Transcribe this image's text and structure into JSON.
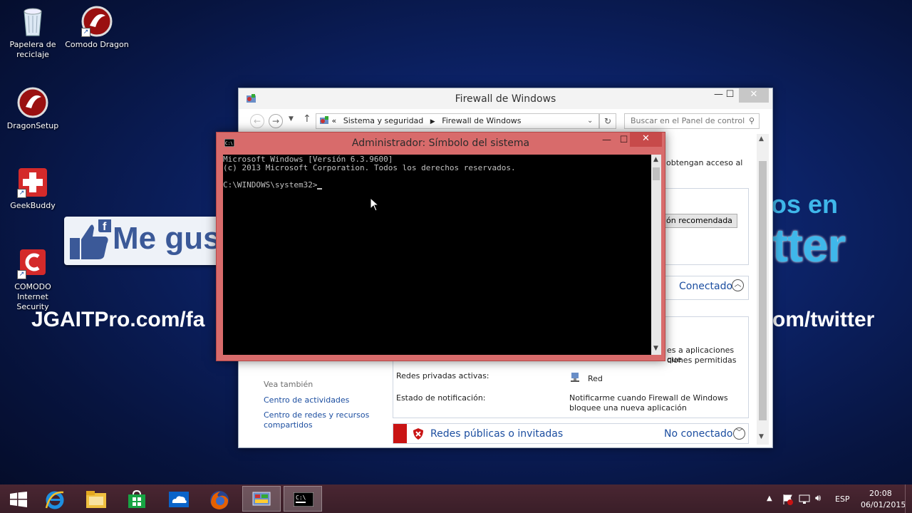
{
  "desktop": {
    "icons": [
      {
        "label": "Papelera de reciclaje",
        "icon": "recycle-bin-icon"
      },
      {
        "label": "Comodo Dragon",
        "icon": "comodo-dragon-icon"
      },
      {
        "label": "DragonSetup",
        "icon": "dragon-setup-icon"
      },
      {
        "label": "GeekBuddy",
        "icon": "geekbuddy-icon"
      },
      {
        "label": "COMODO Internet Security",
        "icon": "comodo-security-icon"
      }
    ],
    "wallpaper": {
      "like_text": "Me gus",
      "facebook_url": "JGAITPro.com/fa",
      "twitter_url": "om/twitter",
      "twitter_head": "os en",
      "twitter_word": "tter"
    }
  },
  "firewall_window": {
    "title": "Firewall de Windows",
    "breadcrumb": [
      "Sistema y seguridad",
      "Firewall de Windows"
    ],
    "breadcrumb_prefix": "«",
    "search_placeholder": "Buscar en el Panel de control",
    "controls": {
      "minimize": "—",
      "maximize": "☐",
      "close": "✕"
    },
    "text_fragment_access": "obtengan acceso al",
    "button_recommended": "ón recomendada",
    "private_status": "Conectado",
    "fragment_apps_1": "es a aplicaciones que",
    "fragment_apps_2": "ciones permitidas",
    "active_private_label": "Redes privadas activas:",
    "active_private_value": "Red",
    "notify_label": "Estado de notificación:",
    "notify_value_1": "Notificarme cuando Firewall de Windows",
    "notify_value_2": "bloquee una nueva aplicación",
    "see_also": "Vea también",
    "link_activity_center": "Centro de actividades",
    "link_network_center_1": "Centro de redes y recursos",
    "link_network_center_2": "compartidos",
    "public_networks_label": "Redes públicas o invitadas",
    "public_status": "No conectado"
  },
  "cmd_window": {
    "title": "Administrador: Símbolo del sistema",
    "controls": {
      "minimize": "—",
      "maximize": "☐",
      "close": "✕"
    },
    "lines": [
      "Microsoft Windows [Versión 6.3.9600]",
      "(c) 2013 Microsoft Corporation. Todos los derechos reservados.",
      "",
      "C:\\WINDOWS\\system32>"
    ]
  },
  "taskbar": {
    "items": [
      {
        "name": "start",
        "icon": "windows-start-icon"
      },
      {
        "name": "internet-explorer",
        "icon": "internet-explorer-icon"
      },
      {
        "name": "file-explorer",
        "icon": "folder-icon"
      },
      {
        "name": "store",
        "icon": "store-icon"
      },
      {
        "name": "onedrive",
        "icon": "onedrive-icon"
      },
      {
        "name": "firefox",
        "icon": "firefox-icon"
      },
      {
        "name": "control-panel",
        "icon": "control-panel-icon"
      },
      {
        "name": "command-prompt",
        "icon": "cmd-icon"
      }
    ],
    "language": "ESP",
    "time": "20:08",
    "date": "06/01/2015"
  },
  "colors": {
    "cmd_frame": "#d86b6b",
    "taskbar": "#3e2029",
    "desktop": "#0c2266",
    "link": "#1c4ea0"
  }
}
